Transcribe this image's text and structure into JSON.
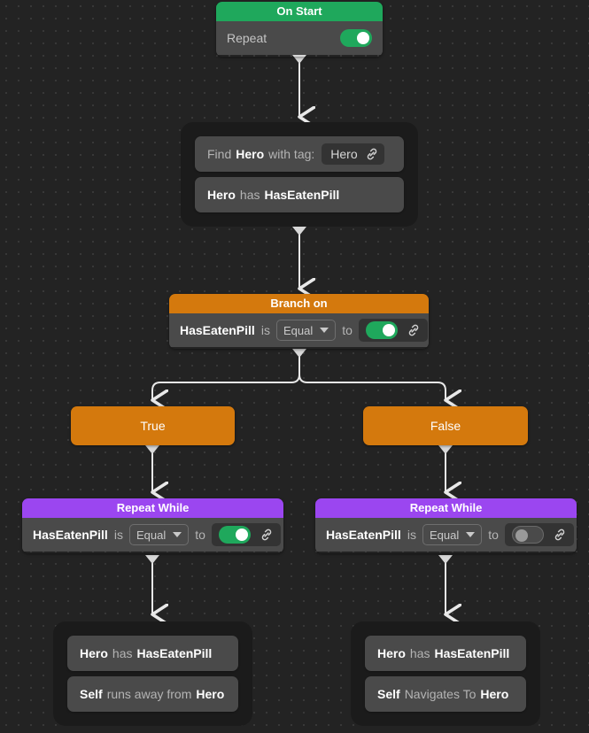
{
  "canvas": {
    "background_color": "#232323",
    "grid": "dot-grid",
    "grid_dot_color": "#3a3a3a",
    "grid_spacing_px": 14
  },
  "colors": {
    "header_green": "#1fa85c",
    "header_orange": "#d4790d",
    "header_purple": "#9b46f0",
    "node_body": "#4a4a4a",
    "group_container": "#1b1b1b",
    "toggle_on": "#1fa85c",
    "toggle_off": "#4a4a4a",
    "edge": "#e8e8e8"
  },
  "nodes": {
    "on_start": {
      "title": "On Start",
      "repeat_label": "Repeat",
      "repeat_toggle": "on"
    },
    "find_group": {
      "find_prefix": "Find",
      "find_target": "Hero",
      "find_suffix": "with tag:",
      "tag_value": "Hero",
      "tag_link_icon": "link-icon",
      "has_subject": "Hero",
      "has_verb": "has",
      "has_object": "HasEatenPill"
    },
    "branch": {
      "title": "Branch on",
      "variable": "HasEatenPill",
      "is_label": "is",
      "operator": "Equal",
      "to_label": "to",
      "value_toggle": "on",
      "link_icon": "link-icon"
    },
    "true_branch": {
      "label": "True"
    },
    "false_branch": {
      "label": "False"
    },
    "repeat_while_left": {
      "title": "Repeat While",
      "variable": "HasEatenPill",
      "is_label": "is",
      "operator": "Equal",
      "to_label": "to",
      "value_toggle": "on",
      "link_icon": "link-icon"
    },
    "repeat_while_right": {
      "title": "Repeat While",
      "variable": "HasEatenPill",
      "is_label": "is",
      "operator": "Equal",
      "to_label": "to",
      "value_toggle": "off",
      "link_icon": "link-icon"
    },
    "true_actions": {
      "row1_subject": "Hero",
      "row1_verb": "has",
      "row1_object": "HasEatenPill",
      "row2_subject": "Self",
      "row2_verb": "runs away from",
      "row2_object": "Hero"
    },
    "false_actions": {
      "row1_subject": "Hero",
      "row1_verb": "has",
      "row1_object": "HasEatenPill",
      "row2_subject": "Self",
      "row2_verb": "Navigates To",
      "row2_object": "Hero"
    }
  }
}
